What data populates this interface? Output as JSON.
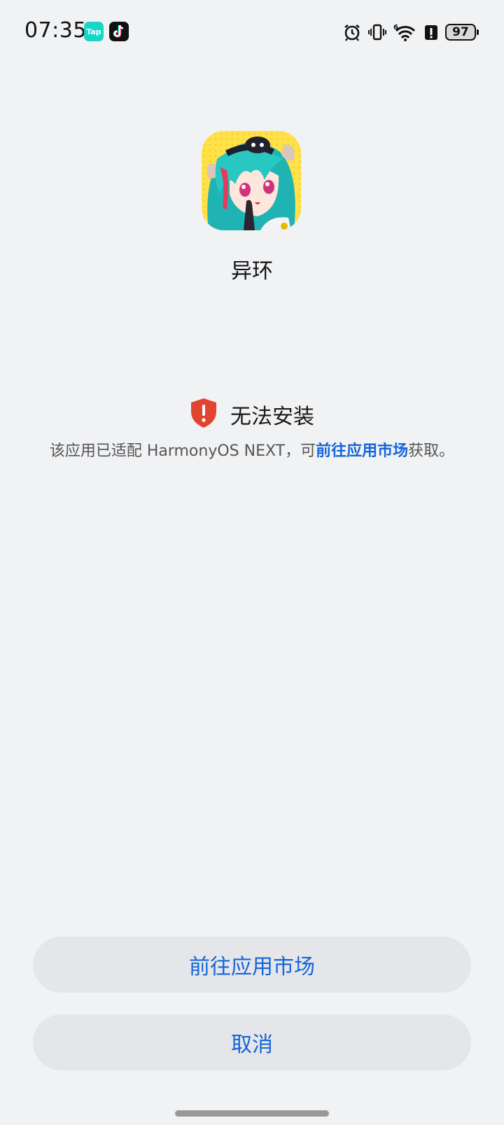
{
  "status_bar": {
    "time": "07:35",
    "notification_icons": [
      "taptap-icon",
      "tiktok-icon"
    ],
    "taptap_label": "Tap",
    "status_icons": [
      "alarm-icon",
      "vibrate-icon",
      "wifi-6-icon",
      "alert-icon"
    ],
    "battery": "97"
  },
  "app": {
    "icon": "app-icon-anime-character",
    "name": "异环"
  },
  "warning": {
    "icon": "shield-alert-icon",
    "title": "无法安装",
    "description_prefix": "该应用已适配 HarmonyOS NEXT，可",
    "link_text": "前往应用市场",
    "description_suffix": "获取。"
  },
  "buttons": {
    "market": "前往应用市场",
    "cancel": "取消"
  },
  "colors": {
    "accent": "#1565d8",
    "warning": "#e0452f",
    "background": "#f1f2f4"
  }
}
